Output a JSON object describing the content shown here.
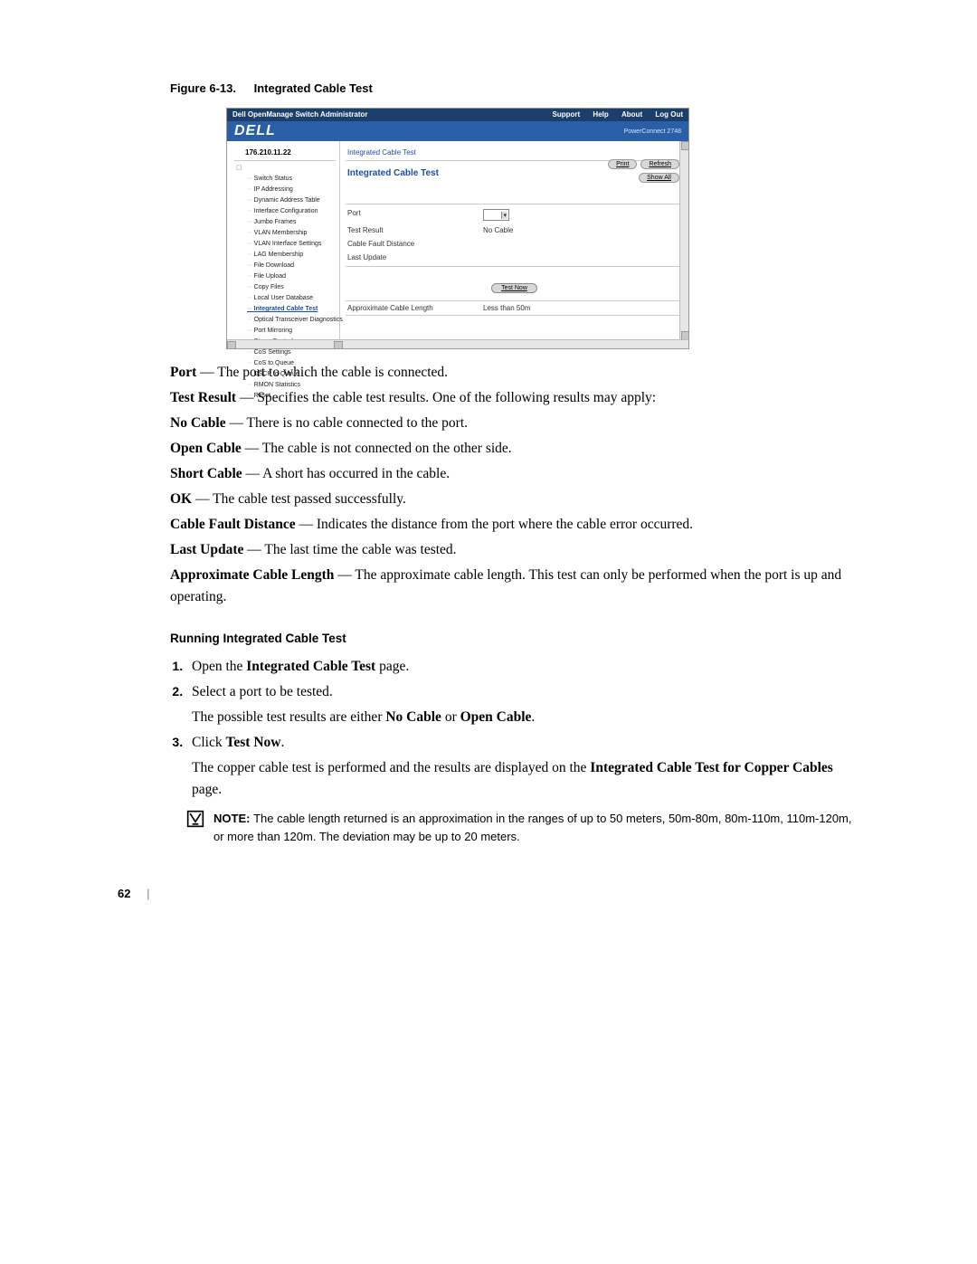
{
  "figure": {
    "label": "Figure 6-13.",
    "title": "Integrated Cable Test"
  },
  "screenshot": {
    "app_title": "Dell OpenManage Switch Administrator",
    "nav_links": {
      "support": "Support",
      "help": "Help",
      "about": "About",
      "logout": "Log Out"
    },
    "brand": "DELL",
    "product": "PowerConnect 2748",
    "ip": "176.210.11.22",
    "breadcrumb": "Integrated Cable Test",
    "panel_title": "Integrated Cable Test",
    "buttons": {
      "print": "Print",
      "refresh": "Refresh",
      "show_all": "Show All"
    },
    "tree": [
      "Switch Status",
      "IP Addressing",
      "Dynamic Address Table",
      "Interface Configuration",
      "Jumbo Frames",
      "VLAN Membership",
      "VLAN Interface Settings",
      "LAG Membership",
      "File Download",
      "File Upload",
      "Copy Files",
      "Local User Database",
      "Integrated Cable Test",
      "Optical Transceiver Diagnostics",
      "Port Mirroring",
      "Storm Control",
      "CoS Settings",
      "CoS to Queue",
      "DSCP to Queue",
      "RMON Statistics",
      "Reset"
    ],
    "active_tree_index": 12,
    "fields": {
      "port": {
        "label": "Port",
        "value": ""
      },
      "test_result": {
        "label": "Test Result",
        "value": "No Cable"
      },
      "cable_fault_distance": {
        "label": "Cable Fault Distance",
        "value": ""
      },
      "last_update": {
        "label": "Last Update",
        "value": ""
      },
      "approx_length": {
        "label": "Approximate Cable Length",
        "value": "Less than 50m"
      }
    },
    "test_now": "Test Now"
  },
  "descriptions": {
    "port_term": "Port",
    "port_desc": " — The port to which the cable is connected.",
    "testresult_term": "Test Result",
    "testresult_desc": " — Specifies the cable test results. One of the following results may apply:",
    "no_cable_term": "No Cable",
    "no_cable_desc": " — There is no cable connected to the port.",
    "open_cable_term": "Open Cable",
    "open_cable_desc": " — The cable is not connected on the other side.",
    "short_cable_term": "Short Cable",
    "short_cable_desc": " — A short has occurred in the cable.",
    "ok_term": "OK",
    "ok_desc": " — The cable test passed successfully.",
    "cfd_term": "Cable Fault Distance",
    "cfd_desc": " — Indicates the distance from the port where the cable error occurred.",
    "lastupdate_term": "Last Update",
    "lastupdate_desc": " — The last time the cable was tested.",
    "approx_term": "Approximate Cable Length",
    "approx_desc": " — The approximate cable length. This test can only be performed when the port is up and operating."
  },
  "procedure": {
    "heading": "Running Integrated Cable Test",
    "s1a": "Open the ",
    "s1b": "Integrated Cable Test",
    "s1c": " page.",
    "s2": "Select a port to be tested.",
    "s2b_a": "The possible test results are either ",
    "s2b_b": "No Cable",
    "s2b_c": " or ",
    "s2b_d": "Open Cable",
    "s2b_e": ".",
    "s3a": "Click ",
    "s3b": "Test Now",
    "s3c": ".",
    "s3_2a": "The copper cable test is performed and the results are displayed on the ",
    "s3_2b": "Integrated Cable Test for Copper Cables",
    "s3_2c": " page."
  },
  "note": {
    "label": "NOTE: ",
    "text": "The cable length returned is an approximation in the ranges of up to 50 meters, 50m-80m, 80m-110m, 110m-120m, or more than 120m. The deviation may be up to 20 meters."
  },
  "page_number": "62"
}
